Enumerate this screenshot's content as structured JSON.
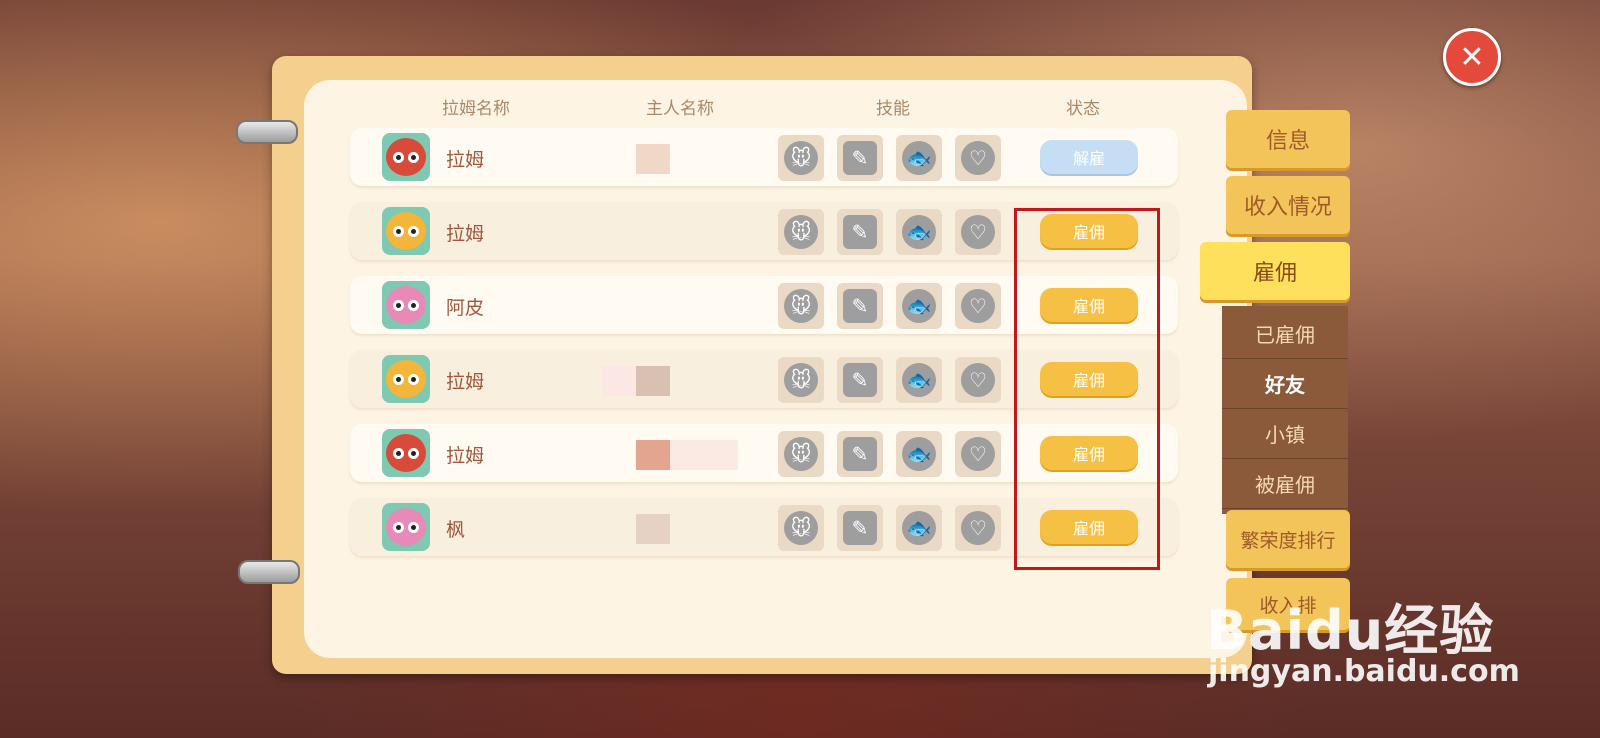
{
  "header": {
    "ram_name": "拉姆名称",
    "owner_name": "主人名称",
    "skills": "技能",
    "status": "状态"
  },
  "rows": [
    {
      "name": "拉姆",
      "status": "解雇",
      "color": "#d84a3a"
    },
    {
      "name": "拉姆",
      "status": "雇佣",
      "color": "#f3b63a"
    },
    {
      "name": "阿皮",
      "status": "雇佣",
      "color": "#e88ab7"
    },
    {
      "name": "拉姆",
      "status": "雇佣",
      "color": "#f3b63a"
    },
    {
      "name": "拉姆",
      "status": "雇佣",
      "color": "#d84a3a"
    },
    {
      "name": "枫",
      "status": "雇佣",
      "color": "#e88ab7"
    }
  ],
  "skill_icons": [
    "mouse-icon",
    "notebook-icon",
    "fish-icon",
    "heart-icon"
  ],
  "tabs": {
    "info": "信息",
    "income": "收入情况",
    "hire": "雇佣",
    "prosperity": "繁荣度排行",
    "income_rank": "收入排"
  },
  "hire_subtabs": [
    "已雇佣",
    "好友",
    "小镇",
    "被雇佣"
  ],
  "close_symbol": "✕",
  "watermark": {
    "logo_text": "Baidu经验",
    "url": "jingyan.baidu.com"
  }
}
